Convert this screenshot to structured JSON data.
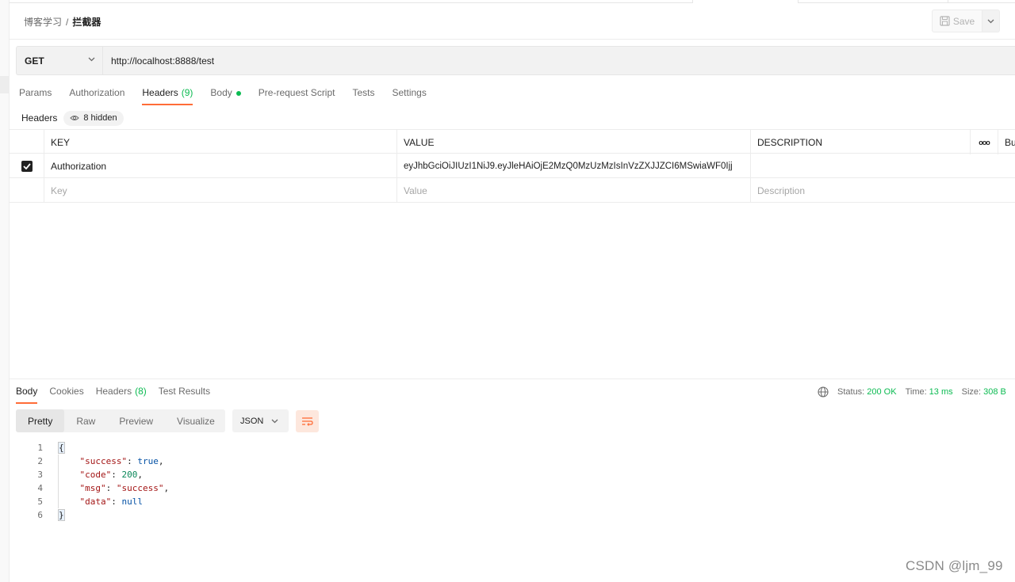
{
  "breadcrumb": {
    "collection": "博客学习",
    "separator": "/",
    "request": "拦截器"
  },
  "toolbar": {
    "save_label": "Save"
  },
  "request": {
    "method": "GET",
    "url": "http://localhost:8888/test"
  },
  "request_tabs": [
    {
      "label": "Params",
      "count": ""
    },
    {
      "label": "Authorization",
      "count": ""
    },
    {
      "label": "Headers",
      "count": "(9)"
    },
    {
      "label": "Body",
      "count": ""
    },
    {
      "label": "Pre-request Script",
      "count": ""
    },
    {
      "label": "Tests",
      "count": ""
    },
    {
      "label": "Settings",
      "count": ""
    }
  ],
  "headers_bar": {
    "label": "Headers",
    "hidden": "8 hidden"
  },
  "headers_table": {
    "columns": {
      "key": "KEY",
      "value": "VALUE",
      "description": "DESCRIPTION",
      "more": "ooo",
      "bulk": "Bu"
    },
    "rows": [
      {
        "checked": true,
        "key": "Authorization",
        "value": "eyJhbGciOiJIUzI1NiJ9.eyJleHAiOjE2MzQ0MzUzMzIsInVzZXJJZCI6MSwiaWF0Ijj",
        "description": ""
      }
    ],
    "placeholders": {
      "key": "Key",
      "value": "Value",
      "description": "Description"
    }
  },
  "response_tabs": [
    {
      "label": "Body",
      "count": ""
    },
    {
      "label": "Cookies",
      "count": ""
    },
    {
      "label": "Headers",
      "count": "(8)"
    },
    {
      "label": "Test Results",
      "count": ""
    }
  ],
  "response_status": {
    "status_label": "Status:",
    "status_value": "200 OK",
    "time_label": "Time:",
    "time_value": "13 ms",
    "size_label": "Size:",
    "size_value": "308 B"
  },
  "view_modes": [
    "Pretty",
    "Raw",
    "Preview",
    "Visualize"
  ],
  "format": "JSON",
  "code_lines": [
    "1",
    "2",
    "3",
    "4",
    "5",
    "6"
  ],
  "response_json": {
    "open": "{",
    "close": "}",
    "success_key": "\"success\"",
    "success_val": "true",
    "code_key": "\"code\"",
    "code_val": "200",
    "msg_key": "\"msg\"",
    "msg_val": "\"success\"",
    "data_key": "\"data\"",
    "data_val": "null"
  },
  "watermark": "CSDN @ljm_99"
}
